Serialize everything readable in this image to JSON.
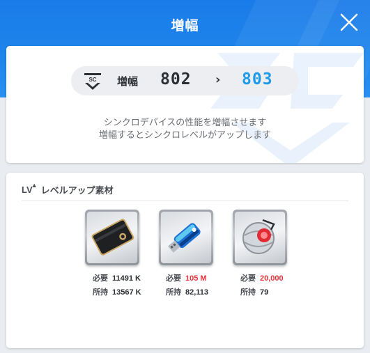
{
  "header": {
    "title": "増幅"
  },
  "level": {
    "label": "増幅",
    "from": "802",
    "to": "803"
  },
  "description": {
    "line1": "シンクロデバイスの性能を増幅させます",
    "line2": "増幅するとシンクロレベルがアップします"
  },
  "materials": {
    "badge": "LV",
    "title": "レベルアップ素材",
    "required_label": "必要",
    "owned_label": "所持",
    "items": [
      {
        "icon": "black-card-icon",
        "required": "11491 K",
        "owned": "13567 K",
        "insufficient": false
      },
      {
        "icon": "usb-drive-icon",
        "required": "105 M",
        "owned": "82,113",
        "insufficient": true
      },
      {
        "icon": "red-core-sphere-icon",
        "required": "20,000",
        "owned": "79",
        "insufficient": true
      }
    ]
  },
  "colors": {
    "header_blue": "#1a7be8",
    "accent_blue": "#1e9be8",
    "insufficient_red": "#e8323a"
  }
}
